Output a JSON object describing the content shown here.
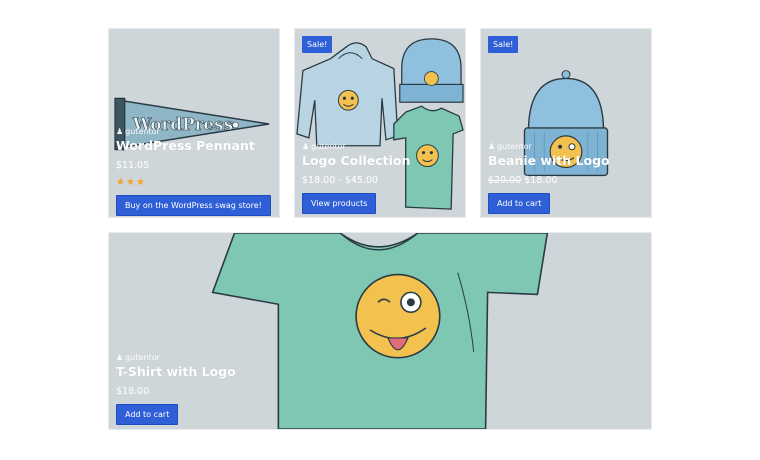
{
  "products": [
    {
      "author": "gutentor",
      "title": "WordPress Pennant",
      "price": "$11.05",
      "rating_stars": 3,
      "button": "Buy on the WordPress swag store!",
      "pennant_text": "WordPress"
    },
    {
      "badge": "Sale!",
      "author": "gutentor",
      "title": "Logo Collection",
      "price": "$18.00 - $45.00",
      "button": "View products"
    },
    {
      "badge": "Sale!",
      "author": "gutentor",
      "title": "Beanie with Logo",
      "old_price": "$20.00",
      "price": "$18.00",
      "button": "Add to cart"
    },
    {
      "author": "gutentor",
      "title": "T-Shirt with Logo",
      "price": "$18.00",
      "button": "Add to cart"
    }
  ],
  "colors": {
    "card_bg": "#cfd6da",
    "button": "#2f5fd6",
    "star": "#f0a22a",
    "shirt": "#7ec8b3",
    "beanie": "#8fc0de",
    "hoodie": "#b8d4e2",
    "emoji": "#f2c14e"
  },
  "icons": {
    "author": "user-icon",
    "rating": "star-icon"
  }
}
